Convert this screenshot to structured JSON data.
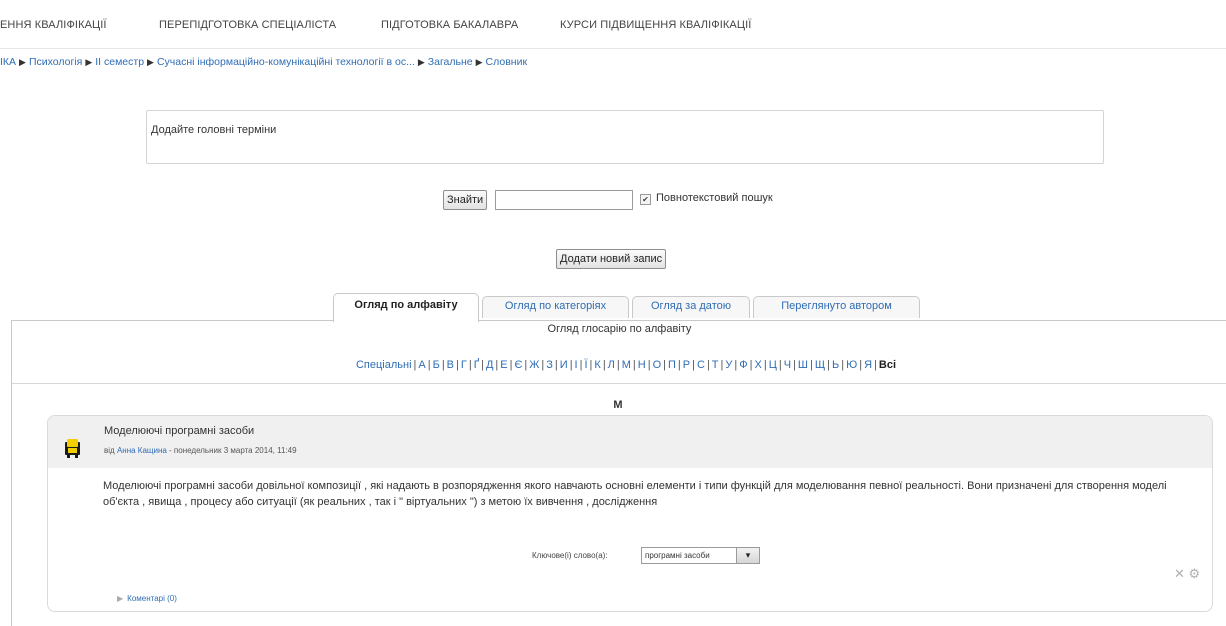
{
  "topnav": {
    "items": [
      "ЕННЯ КВАЛІФІКАЦІЇ",
      "ПЕРЕПІДГОТОВКА СПЕЦІАЛІСТА",
      "ПІДГОТОВКА БАКАЛАВРА",
      "КУРСИ ПІДВИЩЕННЯ КВАЛІФІКАЦІЇ"
    ]
  },
  "breadcrumb": {
    "items": [
      "ІКА",
      "Психологія",
      "ІІ семестр",
      "Сучасні інформаційно-комунікаційні технології в ос...",
      "Загальне",
      "Словник"
    ],
    "separator": "▶"
  },
  "intro": {
    "text": "Додайте головні терміни"
  },
  "search": {
    "button_label": "Знайти",
    "input_value": "",
    "fulltext_label": "Повнотекстовий пошук",
    "fulltext_checked": true
  },
  "add_entry": {
    "label": "Додати новий запис"
  },
  "tabs": [
    {
      "label": "Огляд по алфавіту",
      "active": true
    },
    {
      "label": "Огляд по категоріях",
      "active": false
    },
    {
      "label": "Огляд за датою",
      "active": false
    },
    {
      "label": "Переглянуто автором",
      "active": false
    }
  ],
  "panel": {
    "caption": "Огляд глосарію по алфавіту",
    "alphabet": [
      "Спеціальні",
      "А",
      "Б",
      "В",
      "Г",
      "Ґ",
      "Д",
      "Е",
      "Є",
      "Ж",
      "З",
      "И",
      "І",
      "Ї",
      "К",
      "Л",
      "М",
      "Н",
      "О",
      "П",
      "Р",
      "С",
      "Т",
      "У",
      "Ф",
      "Х",
      "Ц",
      "Ч",
      "Ш",
      "Щ",
      "Ь",
      "Ю",
      "Я"
    ],
    "all_label": "Всі",
    "letter_heading": "М"
  },
  "entry": {
    "term": "Моделюючі програмні засоби",
    "author_prefix": "від",
    "author": "Анна Кащина",
    "date": "- понедельник 3 марта 2014, 11:49",
    "definition": "Моделюючі програмні засоби довільної композиції , які надають в розпорядження якого навчають основні елементи і типи функцій для моделювання певної реальності. Вони призначені для створення моделі об'єкта , явища , процесу або ситуації (як реальних , так і \" віртуальних \") з метою їх вивчення , дослідження",
    "keywords_label": "Ключове(і) слово(а):",
    "keyword_selected": "програмні засоби",
    "comments_label": "Коментарі (0)"
  },
  "colors": {
    "link": "#2f6db5",
    "tab_border": "#c9c9c9",
    "entry_header_bg": "#f0f0f0"
  }
}
